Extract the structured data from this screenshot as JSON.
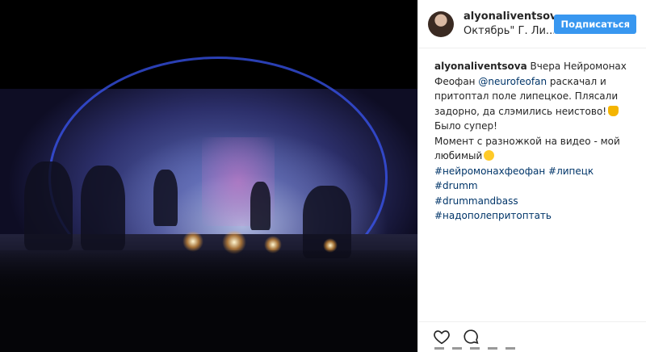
{
  "post": {
    "username": "alyonaliventsova",
    "location": "Октябрь\" Г. Ли...",
    "follow_label": "Подписаться"
  },
  "caption": {
    "author": "alyonaliventsova",
    "text_1": "Вчера Нейромонах Феофан",
    "mention": "@neurofeofan",
    "text_2": "раскачал и притоптал поле липецкое. Плясали задорно, да слэмились неистово!",
    "emoji_1": "thumbs-up-emoji",
    "text_3": "Было супер!",
    "text_4": "Момент с разножкой на видео - мой любимый",
    "emoji_2": "smiling-emoji",
    "hashtags": [
      "#нейромонахфеофан",
      "#липецк",
      "#drumm",
      "#drummandbass",
      "#надополепритоптать"
    ]
  },
  "icons": {
    "like": "heart-icon",
    "comment": "comment-icon"
  },
  "colors": {
    "accent": "#3897f0",
    "link": "#003569"
  }
}
